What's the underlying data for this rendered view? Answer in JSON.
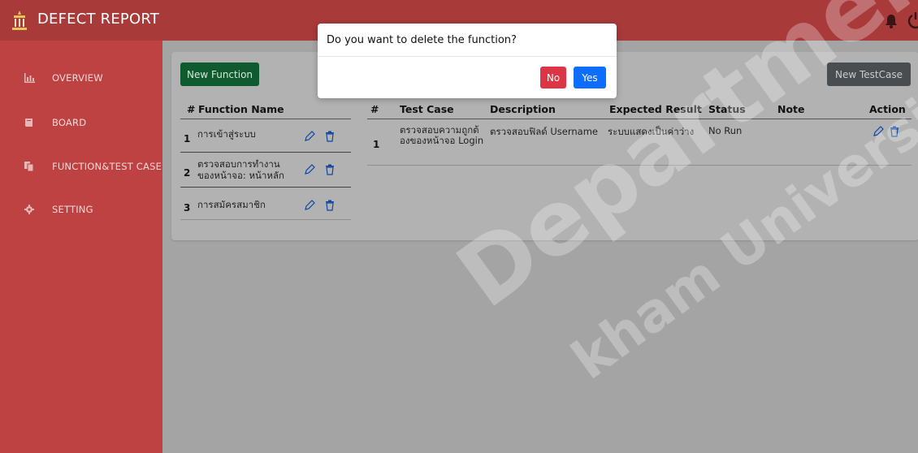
{
  "app": {
    "title": "DEFECT REPORT"
  },
  "sidebar": {
    "items": [
      {
        "label": "OVERVIEW",
        "icon": "bar-chart-icon"
      },
      {
        "label": "BOARD",
        "icon": "book-icon"
      },
      {
        "label": "FUNCTION&TEST CASE",
        "icon": "copy-icon"
      },
      {
        "label": "SETTING",
        "icon": "gear-icon"
      }
    ]
  },
  "toolbar": {
    "new_function_label": "New Function",
    "new_testcase_label": "New TestCase"
  },
  "functions_table": {
    "headers": {
      "num": "#",
      "name": "Function Name"
    },
    "rows": [
      {
        "num": "1",
        "name": "การเข้าสู่ระบบ"
      },
      {
        "num": "2",
        "name": "ตรวจสอบการทำงานของหน้าจอ: หน้าหลัก"
      },
      {
        "num": "3",
        "name": "การสมัครสมาชิก"
      }
    ]
  },
  "testcase_table": {
    "headers": {
      "num": "#",
      "test_case": "Test Case",
      "description": "Description",
      "expected": "Expected Result",
      "status": "Status",
      "note": "Note",
      "action": "Action"
    },
    "rows": [
      {
        "num": "1",
        "test_case": "ตรวจสอบความถูกต้องของหน้าจอ Login",
        "description": "ตรวจสอบฟิลด์ Username",
        "expected": "ระบบแสดงเป็นค่าว่าง",
        "status": "No Run",
        "note": ""
      }
    ]
  },
  "modal": {
    "title": "Do you want to delete the function?",
    "no_label": "No",
    "yes_label": "Yes"
  },
  "watermark": {
    "line1": "Department",
    "line2": "kham University"
  },
  "colors": {
    "topbar": "#a83a3a",
    "sidebar": "#bf4242",
    "danger": "#dc3545",
    "primary": "#0d6efd",
    "success": "#0f5a2e",
    "secondary": "#4a4d50"
  }
}
